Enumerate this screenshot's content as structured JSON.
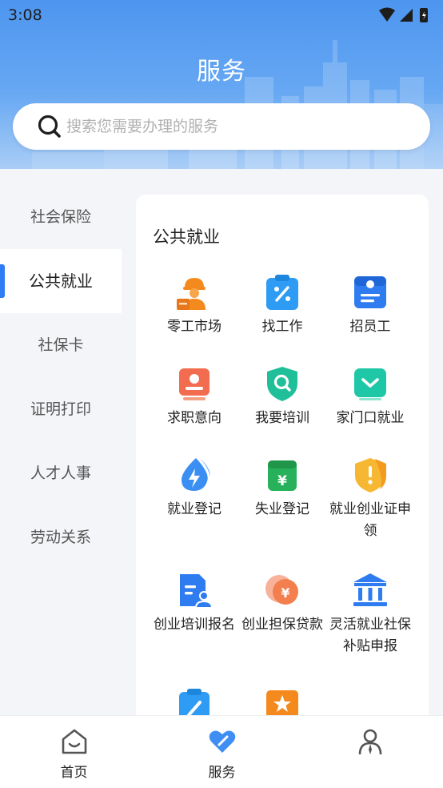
{
  "status": {
    "time": "3:08"
  },
  "header": {
    "title": "服务",
    "search_placeholder": "搜索您需要办理的服务"
  },
  "categories": [
    {
      "label": "社会保险"
    },
    {
      "label": "公共就业",
      "active": true
    },
    {
      "label": "社保卡"
    },
    {
      "label": "证明打印"
    },
    {
      "label": "人才人事"
    },
    {
      "label": "劳动关系"
    }
  ],
  "section": {
    "title": "公共就业",
    "items": [
      {
        "label": "零工市场",
        "icon": "worker-icon"
      },
      {
        "label": "找工作",
        "icon": "clipboard-percent-icon"
      },
      {
        "label": "招员工",
        "icon": "id-card-icon"
      },
      {
        "label": "求职意向",
        "icon": "profile-card-icon"
      },
      {
        "label": "我要培训",
        "icon": "shield-search-icon"
      },
      {
        "label": "家门口就业",
        "icon": "chevron-box-icon"
      },
      {
        "label": "就业登记",
        "icon": "water-drop-bolt-icon"
      },
      {
        "label": "失业登记",
        "icon": "wallet-yuan-icon"
      },
      {
        "label": "就业创业证申领",
        "icon": "shield-alert-icon"
      },
      {
        "label": "创业培训报名",
        "icon": "document-user-icon"
      },
      {
        "label": "创业担保贷款",
        "icon": "coins-yuan-icon"
      },
      {
        "label": "灵活就业社保补贴申报",
        "icon": "bank-icon"
      },
      {
        "label": "",
        "icon": "clipboard-edit-icon"
      },
      {
        "label": "",
        "icon": "star-folder-icon"
      }
    ]
  },
  "tabs": [
    {
      "label": "首页",
      "icon": "home-icon"
    },
    {
      "label": "服务",
      "icon": "heart-service-icon",
      "active": true
    },
    {
      "label": "",
      "icon": "person-icon"
    }
  ],
  "colors": {
    "accent": "#2f7cf6",
    "header_top": "#4d95ef",
    "orange": "#f48a1e",
    "teal": "#1fbf9a",
    "green": "#27b15a",
    "blue_icon": "#2e7cf0"
  }
}
